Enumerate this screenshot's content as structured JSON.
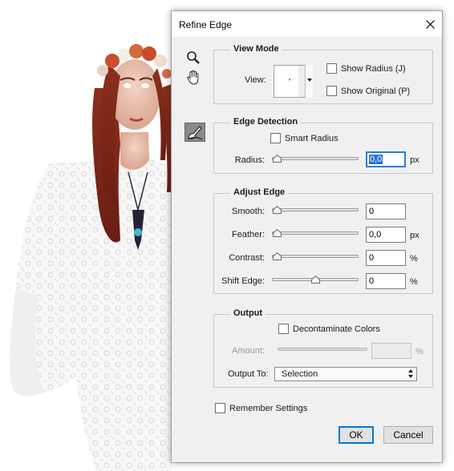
{
  "dialog": {
    "title": "Refine Edge",
    "close_glyph": "×"
  },
  "tools": [
    "zoom-icon",
    "hand-icon",
    "refine-radius-brush-icon"
  ],
  "view_mode": {
    "title": "View Mode",
    "view_label": "View:",
    "show_radius": {
      "label": "Show Radius (J)",
      "checked": false
    },
    "show_original": {
      "label": "Show Original (P)",
      "checked": false
    }
  },
  "edge_detection": {
    "title": "Edge Detection",
    "smart_radius": {
      "label": "Smart Radius",
      "checked": false
    },
    "radius": {
      "label": "Radius:",
      "value": "0,0",
      "unit": "px",
      "slider_fraction": 0.0
    }
  },
  "adjust_edge": {
    "title": "Adjust Edge",
    "smooth": {
      "label": "Smooth:",
      "value": "0",
      "unit": "",
      "slider_fraction": 0.0
    },
    "feather": {
      "label": "Feather:",
      "value": "0,0",
      "unit": "px",
      "slider_fraction": 0.0
    },
    "contrast": {
      "label": "Contrast:",
      "value": "0",
      "unit": "%",
      "slider_fraction": 0.0
    },
    "shift_edge": {
      "label": "Shift Edge:",
      "value": "0",
      "unit": "%",
      "slider_fraction": 0.5
    }
  },
  "output": {
    "title": "Output",
    "decontaminate": {
      "label": "Decontaminate Colors",
      "checked": false
    },
    "amount": {
      "label": "Amount:",
      "value": "",
      "unit": "%",
      "enabled": false
    },
    "output_to": {
      "label": "Output To:",
      "selected": "Selection"
    }
  },
  "remember_settings": {
    "label": "Remember Settings",
    "checked": false
  },
  "buttons": {
    "ok": "OK",
    "cancel": "Cancel"
  },
  "colors": {
    "accent": "#0078d7",
    "selection": "#2b6fd6",
    "dialog_bg": "#f0f0f0"
  }
}
